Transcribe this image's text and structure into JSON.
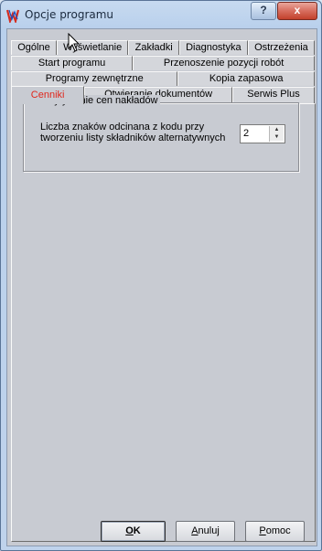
{
  "window": {
    "title": "Opcje programu",
    "help_label": "?",
    "close_label": "x"
  },
  "tabs": {
    "row1": [
      "Ogólne",
      "Wyświetlanie",
      "Zakładki",
      "Diagnostyka",
      "Ostrzeżenia"
    ],
    "row2": [
      "Start programu",
      "Przenoszenie pozycji robót"
    ],
    "row3": [
      "Programy zewnętrzne",
      "Kopia zapasowa"
    ],
    "row4": [
      "Cenniki",
      "Otwieranie dokumentów",
      "Serwis Plus"
    ],
    "active": "Cenniki",
    "active_color": "#e0271c"
  },
  "groupbox": {
    "title": "Wczytywanie cen nakładów",
    "field_label": "Liczba znaków odcinana z kodu przy tworzeniu listy składników alternatywnych",
    "field_value": "2"
  },
  "buttons": {
    "ok": {
      "accel": "O",
      "rest": "K"
    },
    "cancel": {
      "accel": "A",
      "rest": "nuluj"
    },
    "help": {
      "accel": "P",
      "rest": "omoc"
    }
  }
}
